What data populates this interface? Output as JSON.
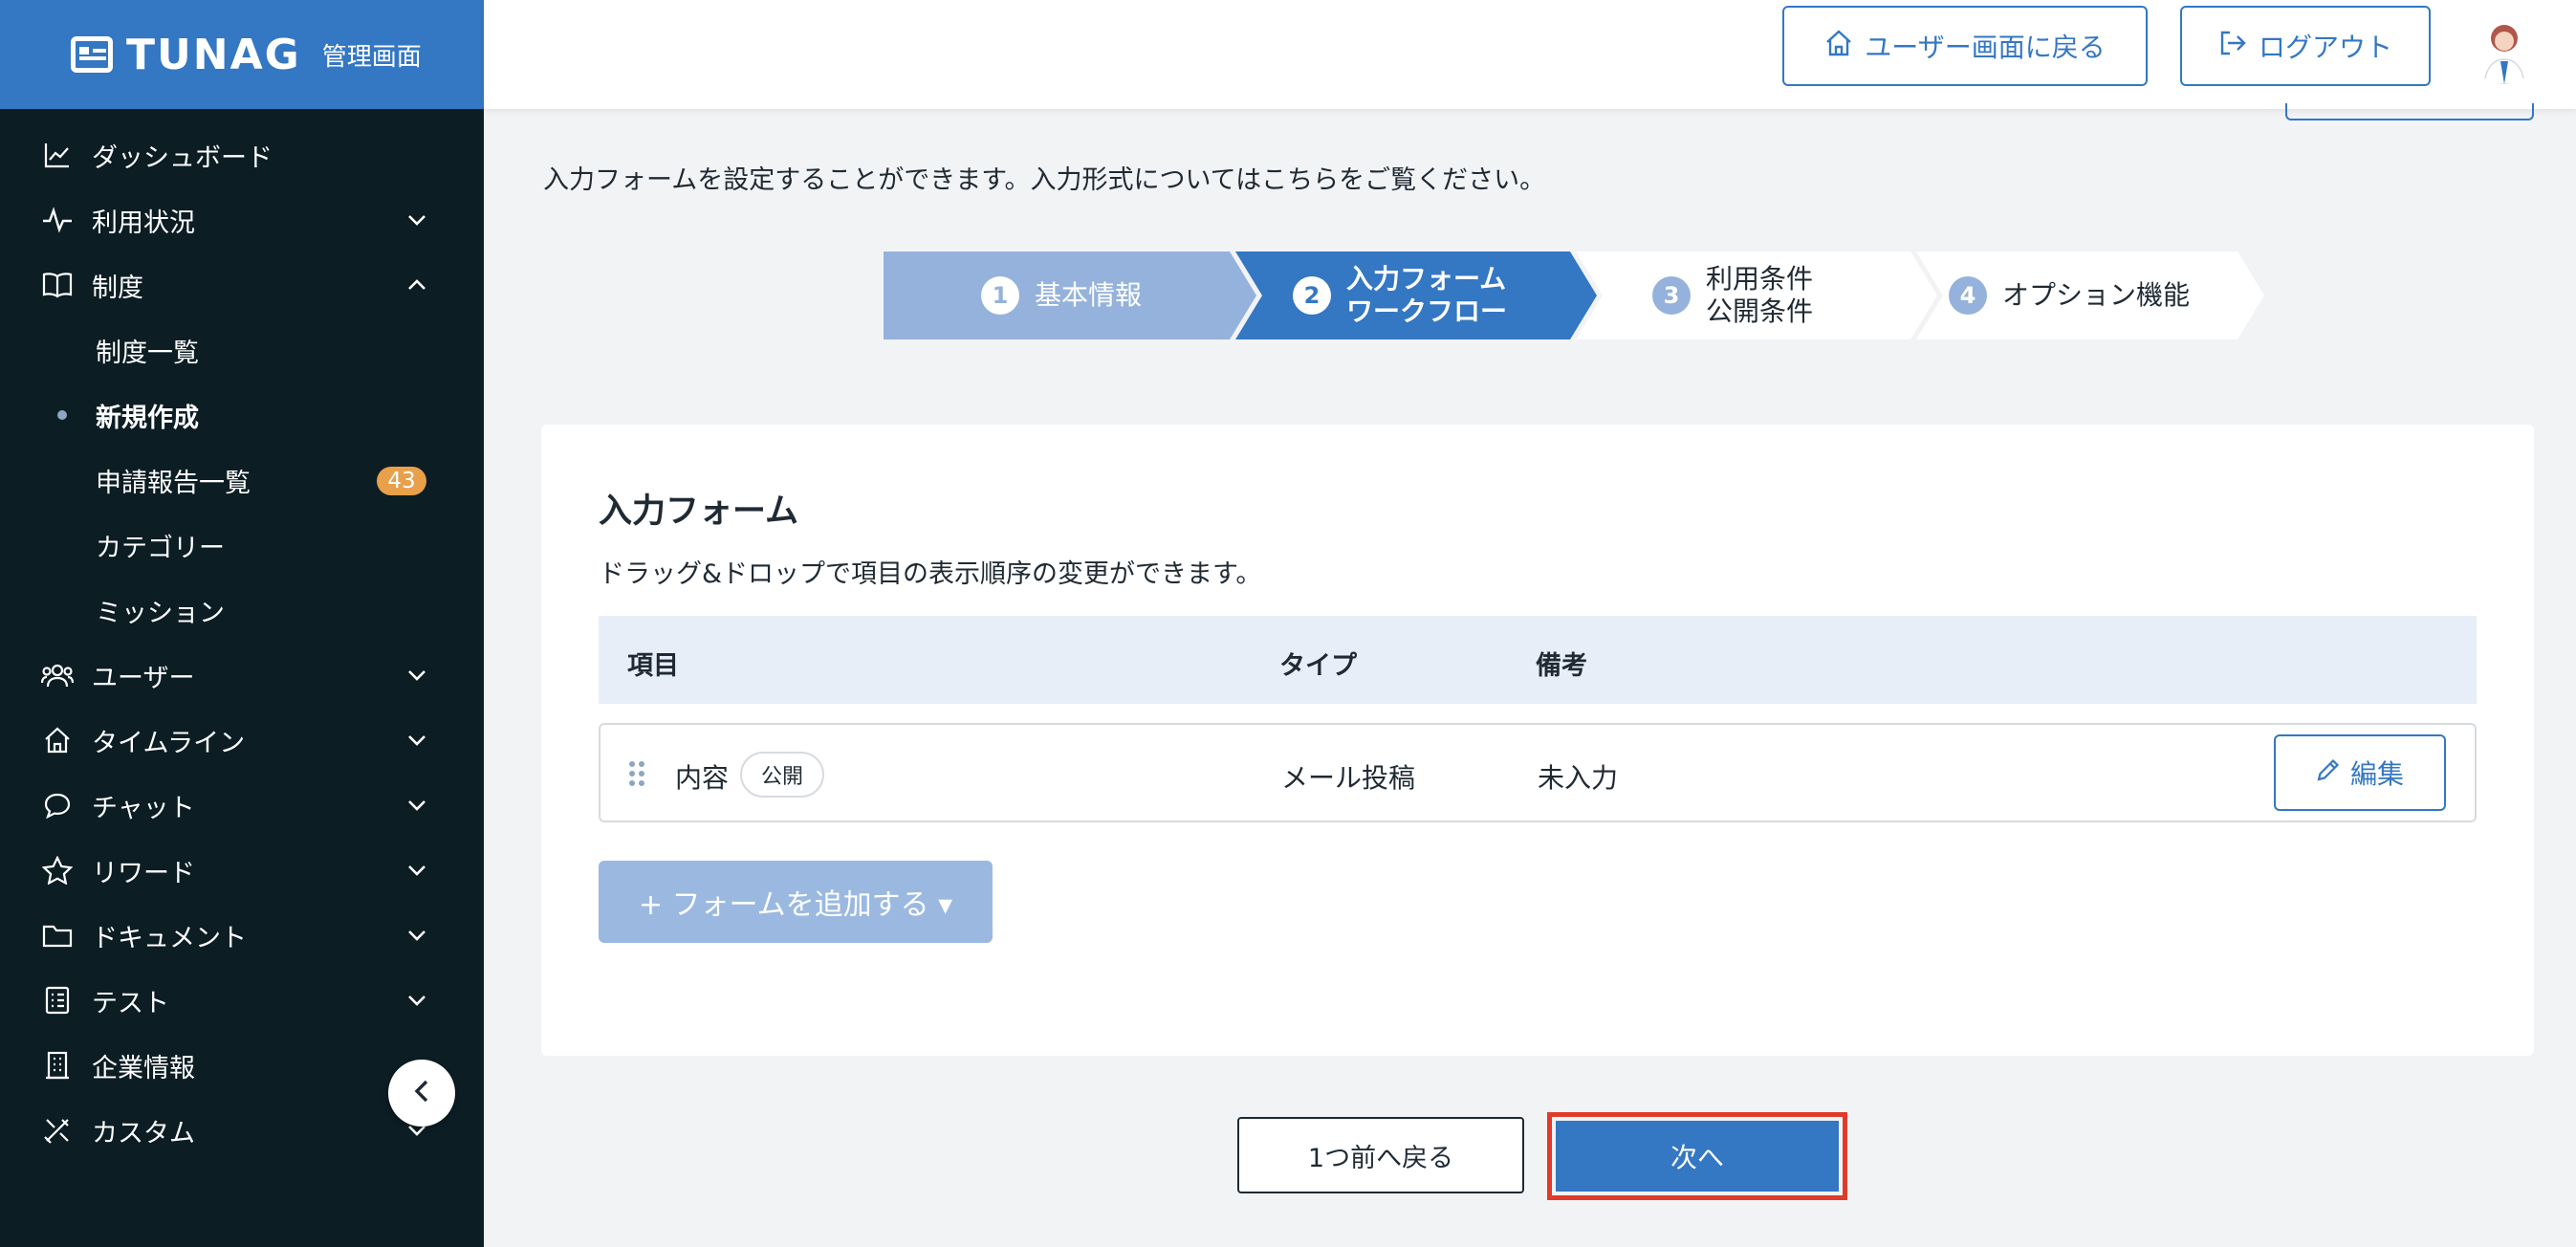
{
  "brand": {
    "name": "TUNAG",
    "admin_label": "管理画面"
  },
  "sidebar": {
    "items": [
      {
        "label": "ダッシュボード",
        "icon": "chart-line-icon"
      },
      {
        "label": "利用状況",
        "icon": "activity-icon"
      },
      {
        "label": "制度",
        "icon": "book-open-icon"
      },
      {
        "label": "ユーザー",
        "icon": "users-icon"
      },
      {
        "label": "タイムライン",
        "icon": "home-icon"
      },
      {
        "label": "チャット",
        "icon": "chat-icon"
      },
      {
        "label": "リワード",
        "icon": "star-icon"
      },
      {
        "label": "ドキュメント",
        "icon": "folder-icon"
      },
      {
        "label": "テスト",
        "icon": "checklist-icon"
      },
      {
        "label": "企業情報",
        "icon": "building-icon"
      },
      {
        "label": "カスタム",
        "icon": "tools-icon"
      }
    ],
    "sub_items": [
      {
        "label": "制度一覧"
      },
      {
        "label": "新規作成"
      },
      {
        "label": "申請報告一覧",
        "badge": "43"
      },
      {
        "label": "カテゴリー"
      },
      {
        "label": "ミッション"
      }
    ]
  },
  "header": {
    "back_label": "ユーザー画面に戻る",
    "logout_label": "ログアウト"
  },
  "intro_text": "入力フォームを設定することができます。入力形式についてはこちらをご覧ください。",
  "steps": [
    {
      "num": "1",
      "line1": "基本情報",
      "line2": "",
      "state": "done"
    },
    {
      "num": "2",
      "line1": "入力フォーム",
      "line2": "ワークフロー",
      "state": "current"
    },
    {
      "num": "3",
      "line1": "利用条件",
      "line2": "公開条件",
      "state": "todo"
    },
    {
      "num": "4",
      "line1": "オプション機能",
      "line2": "",
      "state": "todo"
    }
  ],
  "card": {
    "title": "入力フォーム",
    "desc": "ドラッグ&ドロップで項目の表示順序の変更ができます。",
    "columns": [
      "項目",
      "タイプ",
      "備考"
    ],
    "rows": [
      {
        "item": "内容",
        "tag": "公開",
        "type": "メール投稿",
        "note": "未入力",
        "edit_label": "編集"
      }
    ],
    "add_label": "+ フォームを追加する ▾"
  },
  "footer": {
    "prev_label": "1つ前へ戻る",
    "next_label": "次へ"
  },
  "colors": {
    "primary": "#3477c3",
    "sidebar_bg": "#0c1d24",
    "badge": "#e8a04a",
    "highlight": "#e03a2a"
  }
}
